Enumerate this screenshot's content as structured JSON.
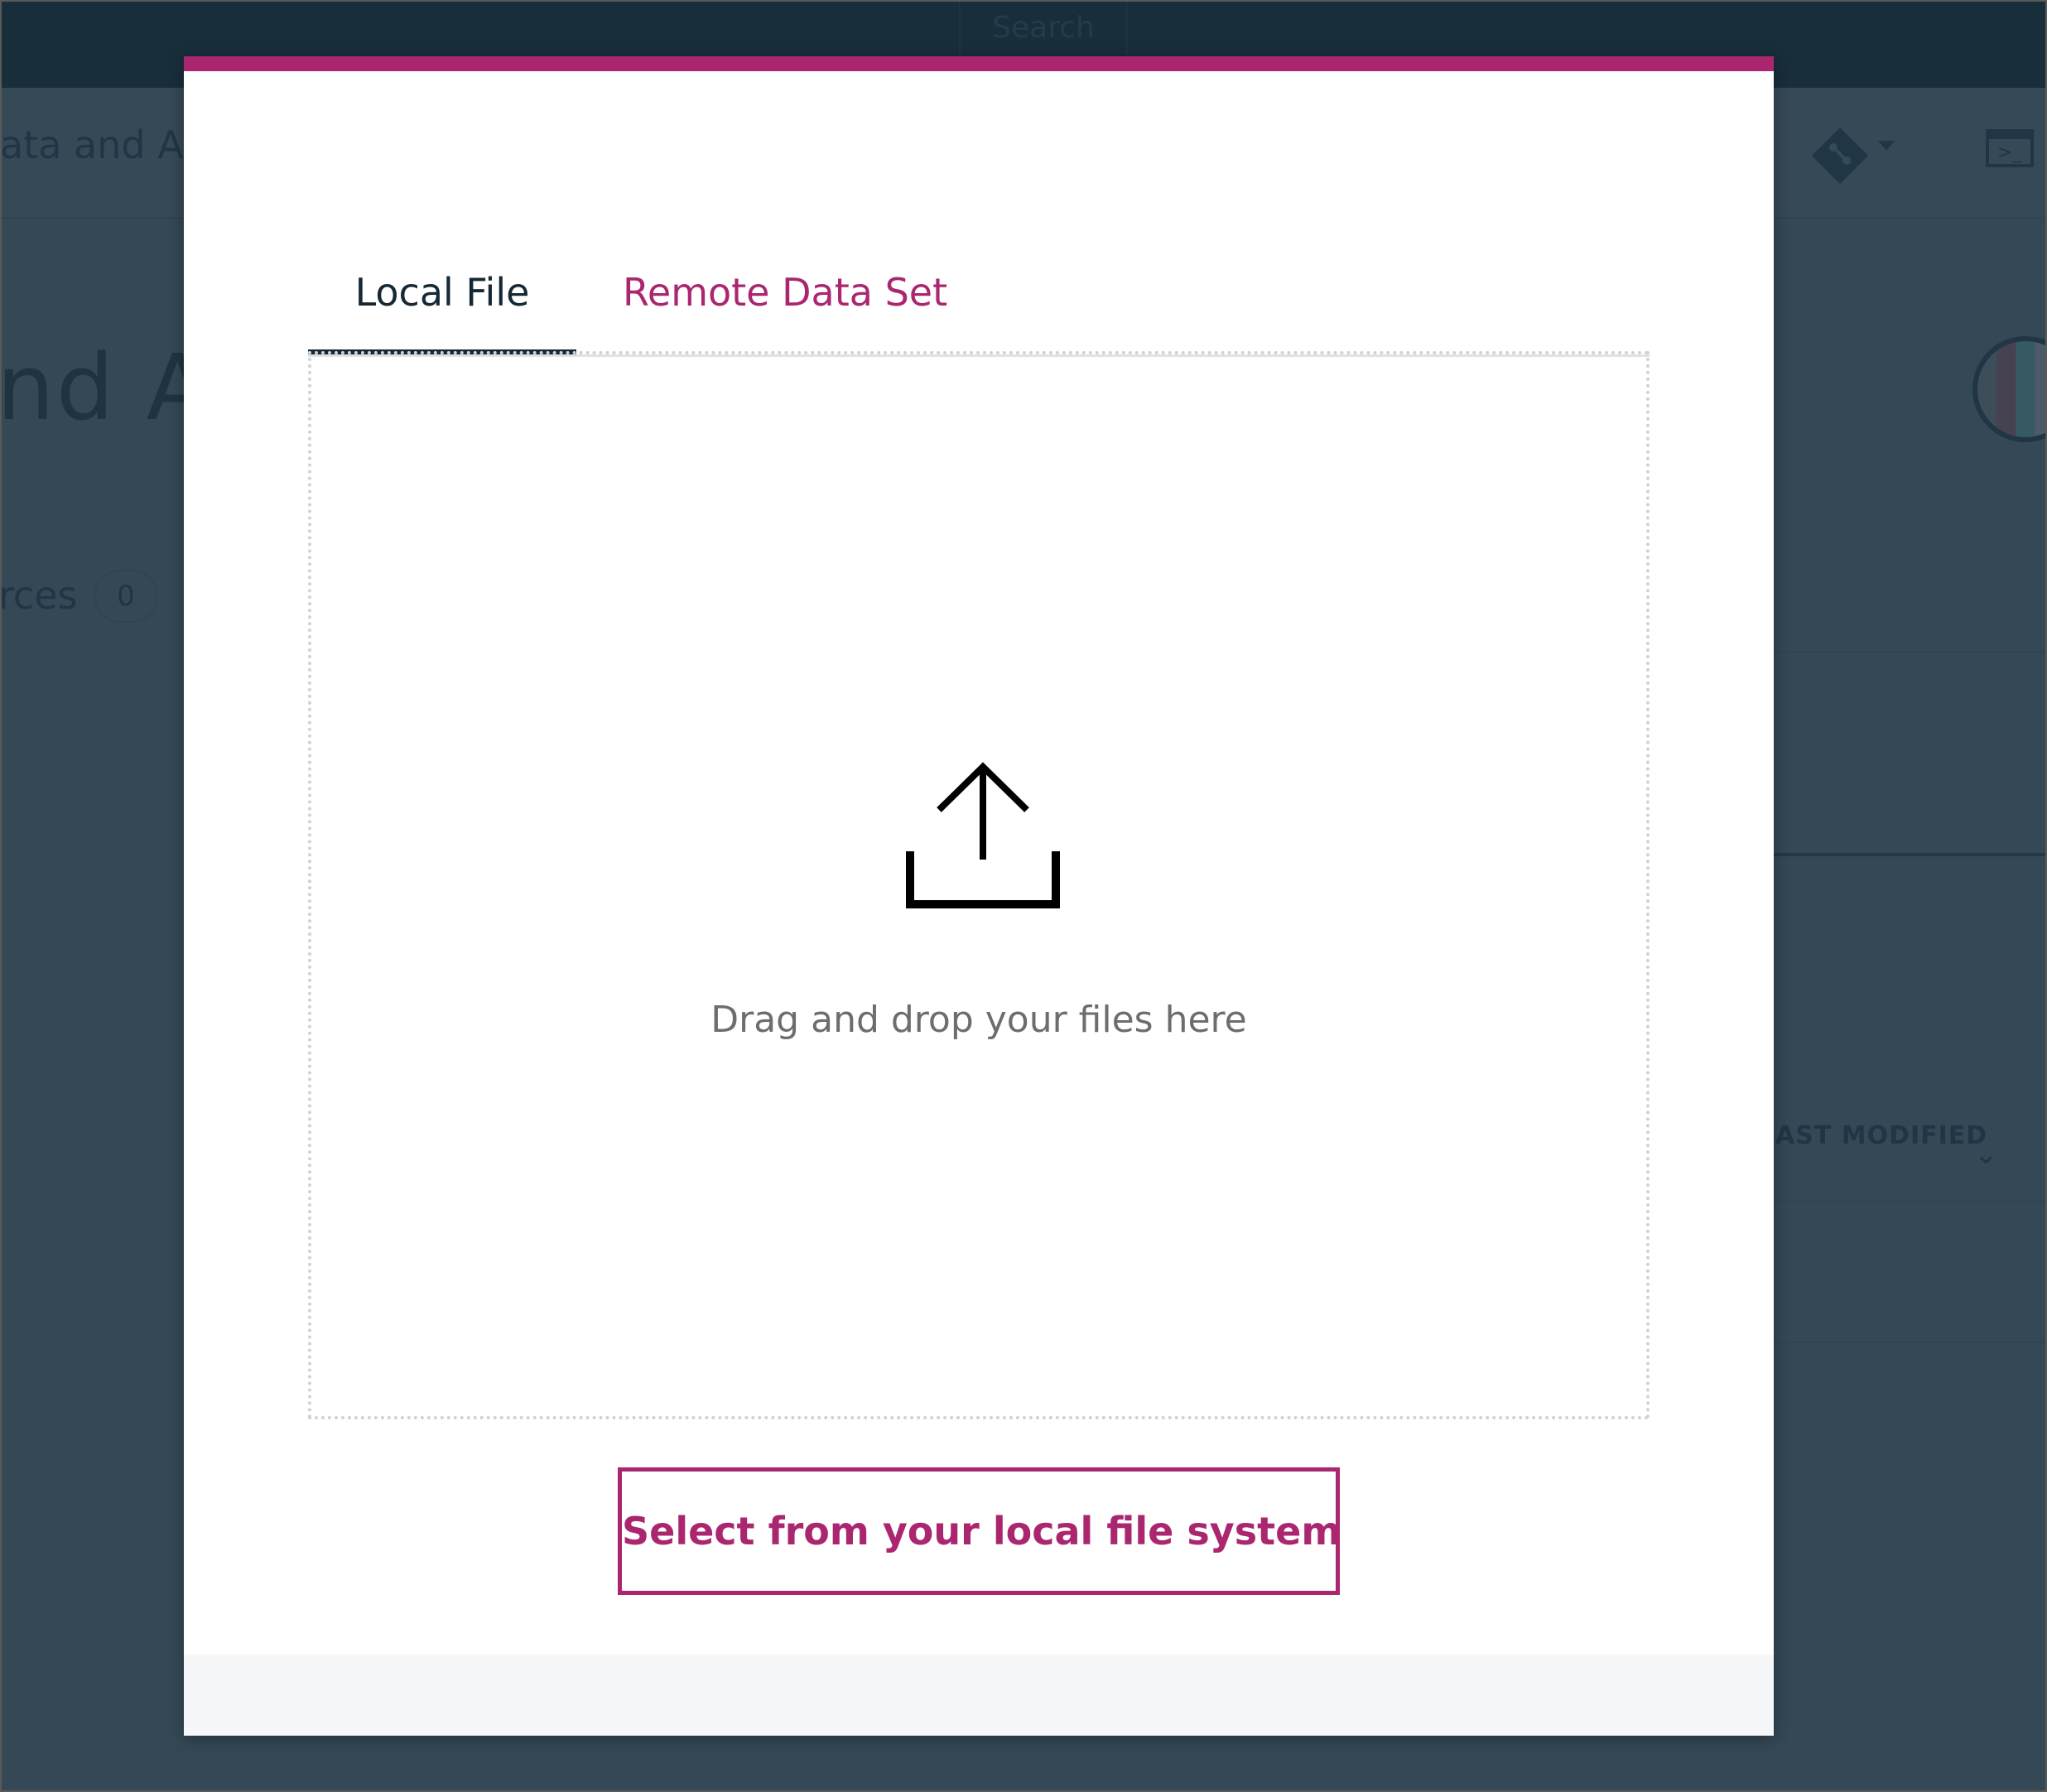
{
  "background": {
    "search_label": "Search",
    "breadcrumb": "ata and AI",
    "project_title": "nd AI",
    "resources_label": "rces",
    "resources_count": "0",
    "terminal_glyph": ">_",
    "column_header": "AST MODIFIED",
    "sort_glyph": "⌄"
  },
  "modal": {
    "accent_color": "#aa2770",
    "tabs": [
      {
        "label": "Local File",
        "selected": true
      },
      {
        "label": "Remote Data Set",
        "selected": false
      }
    ],
    "dropzone": {
      "icon": "upload-icon",
      "text": "Drag and drop your files here"
    },
    "select_button_label": "Select from your local file system"
  }
}
